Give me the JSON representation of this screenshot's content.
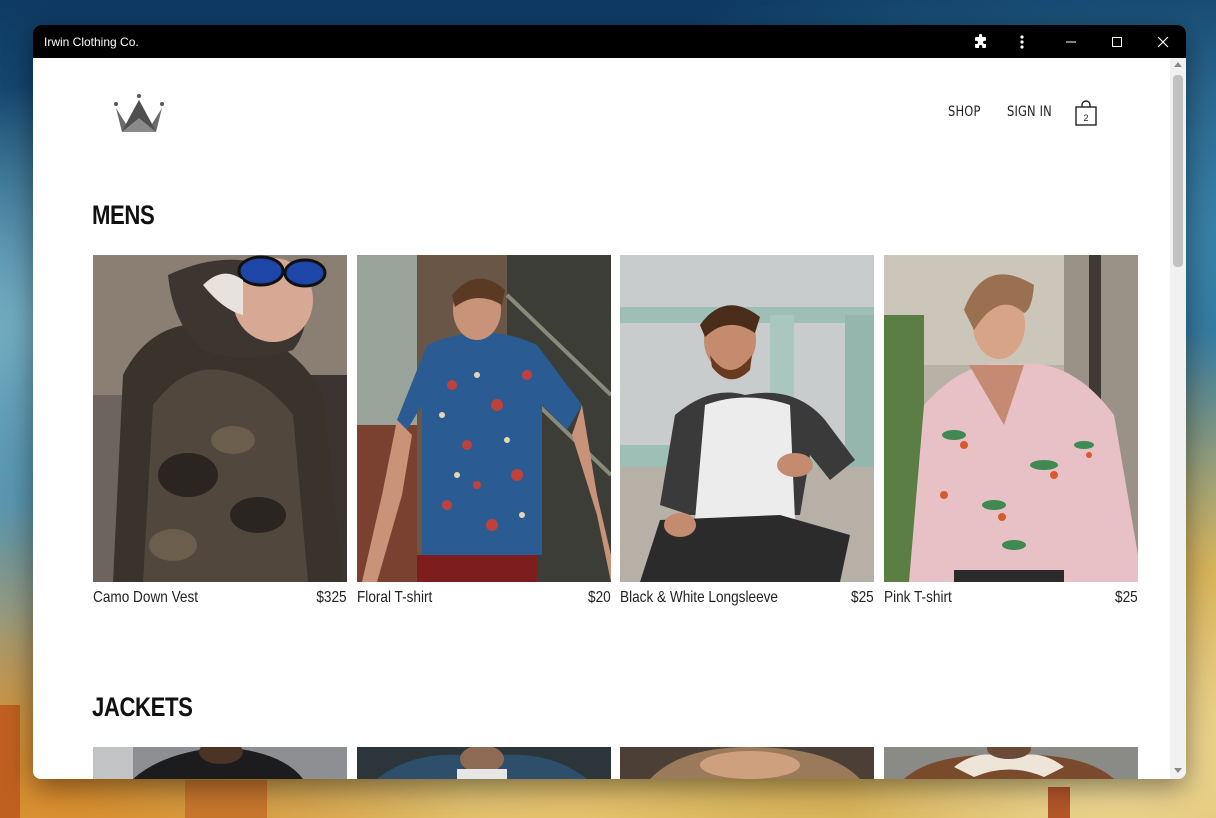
{
  "window": {
    "title": "Irwin Clothing Co."
  },
  "titlebar_icons": [
    "puzzle-extension-icon",
    "more-vertical-icon",
    "minimize-icon",
    "maximize-icon",
    "close-icon"
  ],
  "header": {
    "logo_icon": "crown-icon",
    "nav": {
      "shop_label": "SHOP",
      "signin_label": "SIGN IN"
    },
    "cart": {
      "icon": "shopping-bag-icon",
      "count": "2"
    }
  },
  "sections": {
    "mens": {
      "title": "MENS",
      "products": [
        {
          "name": "Camo Down Vest",
          "price": "$325"
        },
        {
          "name": "Floral T-shirt",
          "price": "$20"
        },
        {
          "name": "Black & White Longsleeve",
          "price": "$25"
        },
        {
          "name": "Pink T-shirt",
          "price": "$25"
        }
      ]
    },
    "jackets": {
      "title": "JACKETS"
    }
  },
  "colors": {
    "titlebar": "#000000",
    "page_background": "#ffffff",
    "text": "#222222"
  }
}
